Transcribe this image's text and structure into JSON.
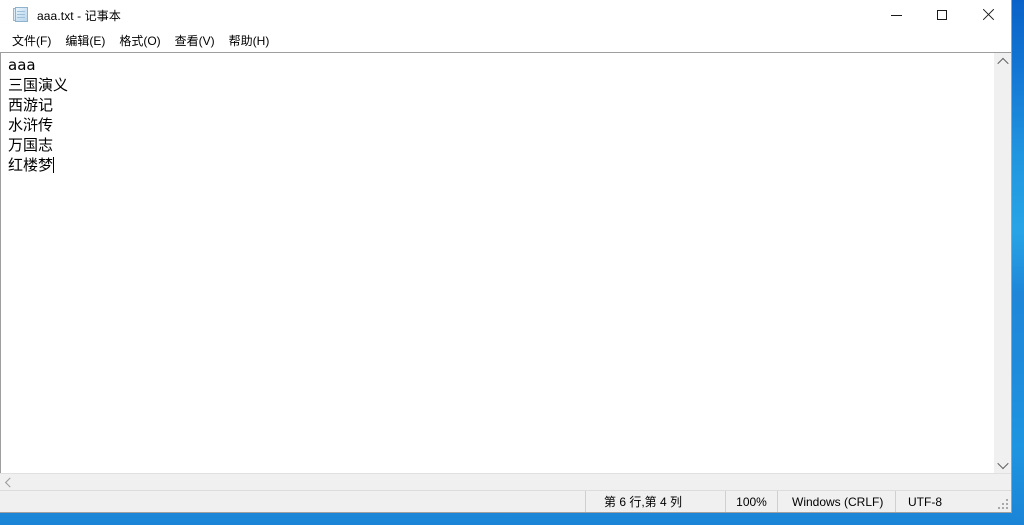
{
  "window": {
    "title": "aaa.txt - 记事本",
    "icon": "notepad-icon"
  },
  "window_controls": {
    "minimize_label": "最小化",
    "maximize_label": "最大化",
    "close_label": "关闭"
  },
  "menu": {
    "items": [
      {
        "label": "文件(F)"
      },
      {
        "label": "编辑(E)"
      },
      {
        "label": "格式(O)"
      },
      {
        "label": "查看(V)"
      },
      {
        "label": "帮助(H)"
      }
    ]
  },
  "editor": {
    "lines": [
      "aaa",
      "三国演义",
      "西游记",
      "水浒传",
      "万国志",
      "红楼梦"
    ],
    "caret_line_index": 5
  },
  "scrollbars": {
    "vertical": {
      "up_arrow": "chevron-up-icon",
      "down_arrow": "chevron-down-icon"
    },
    "horizontal": {
      "left_arrow": "chevron-left-icon"
    }
  },
  "statusbar": {
    "position": "第 6 行,第 4 列",
    "zoom": "100%",
    "line_ending": "Windows (CRLF)",
    "encoding": "UTF-8"
  },
  "colors": {
    "window_bg": "#ffffff",
    "chrome_bg": "#f0f0f0",
    "desktop_blue": "#1f8bdb",
    "text": "#000000"
  }
}
